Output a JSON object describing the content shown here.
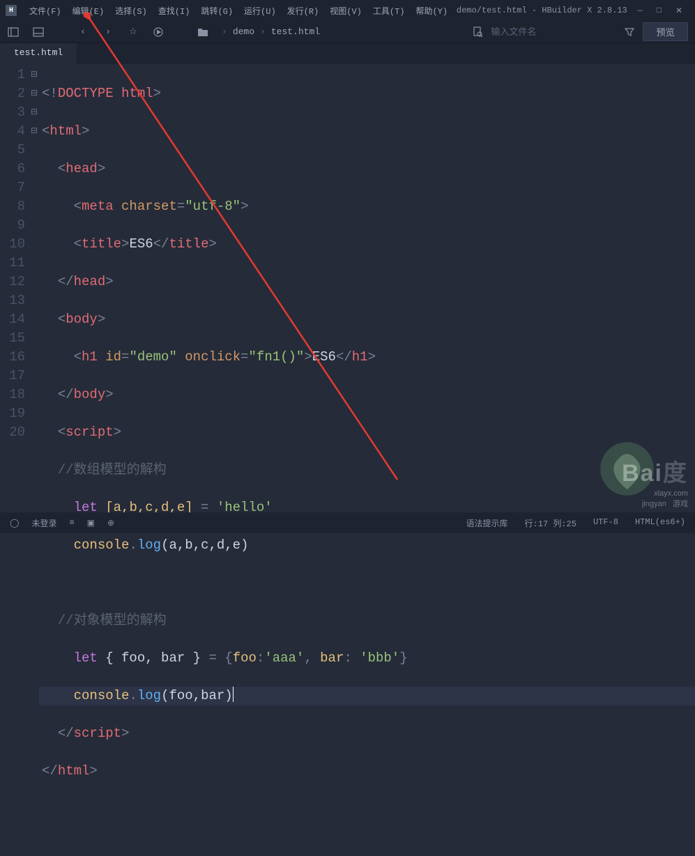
{
  "title": "demo/test.html - HBuilder X 2.8.13",
  "menu": {
    "file": "文件(F)",
    "edit": "编辑(E)",
    "select": "选择(S)",
    "find": "查找(I)",
    "goto": "跳转(G)",
    "run": "运行(U)",
    "publish": "发行(R)",
    "view": "视图(V)",
    "tools": "工具(T)",
    "help": "帮助(Y)"
  },
  "breadcrumb": {
    "folder": "demo",
    "file": "test.html"
  },
  "search_placeholder": "输入文件名",
  "preview_label": "预览",
  "tab_label": "test.html",
  "line_numbers": [
    "1",
    "2",
    "3",
    "4",
    "5",
    "6",
    "7",
    "8",
    "9",
    "10",
    "11",
    "12",
    "13",
    "14",
    "15",
    "16",
    "17",
    "18",
    "19",
    "20"
  ],
  "fold_marks": [
    "",
    "⊟",
    "⊟",
    "",
    "",
    "",
    "⊟",
    "",
    "",
    "⊟",
    "",
    "",
    "",
    "",
    "",
    "",
    "",
    "",
    "",
    ""
  ],
  "code": {
    "l1_doctype": "DOCTYPE html",
    "l2_html": "html",
    "l3_head": "head",
    "l4_meta": "meta",
    "l4_attr_charset": "charset",
    "l4_val_charset": "\"utf-8\"",
    "l5_title": "title",
    "l5_text": "ES6",
    "l6_head_close": "head",
    "l7_body": "body",
    "l8_h1": "h1",
    "l8_attr_id": "id",
    "l8_val_id": "\"demo\"",
    "l8_attr_onclick": "onclick",
    "l8_val_onclick": "\"fn1()\"",
    "l8_text": "ES6",
    "l9_body_close": "body",
    "l10_script": "script",
    "l11_cmt": "//数组模型的解构",
    "l12_let": "let",
    "l12_vars": "[a,b,c,d,e]",
    "l12_eq": " = ",
    "l12_str": "'hello'",
    "l13_console": "console",
    "l13_log": "log",
    "l13_args": "(a,b,c,d,e)",
    "l15_cmt": "//对象模型的解构",
    "l16_let": "let",
    "l16_destr": " { foo, bar } ",
    "l16_eq": "= ",
    "l16_obj_foo_k": "foo",
    "l16_obj_foo_v": "'aaa'",
    "l16_obj_bar_k": "bar",
    "l16_obj_bar_v": "'bbb'",
    "l17_console": "console",
    "l17_log": "log",
    "l17_args": "(foo,bar)",
    "l18_script_close": "script",
    "l19_html_close": "html"
  },
  "status": {
    "login": "未登录",
    "syntax": "语法提示库",
    "cursor": "行:17 列:25",
    "encoding": "UTF-8",
    "lang": "HTML(es6+)"
  },
  "watermark": {
    "big": "Bai",
    "site": "xlayx.com",
    "jy": "jingyan",
    "game": "游戏"
  }
}
